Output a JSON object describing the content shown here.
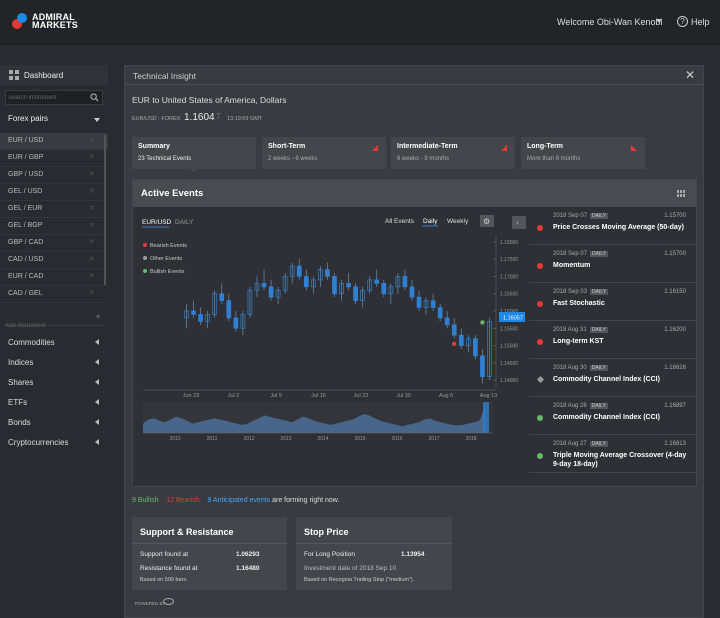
{
  "header": {
    "brand_line1": "ADMIRAL",
    "brand_line2": "MARKETS",
    "welcome": "Welcome Obi-Wan Kenobi",
    "help": "Help"
  },
  "sidebar": {
    "dashboard": "Dashboard",
    "search_placeholder": "Search instrument",
    "forex_label": "Forex pairs",
    "pairs": [
      "EUR / USD",
      "EUR / GBP",
      "GBP / USD",
      "GEL / USD",
      "GEL / EUR",
      "GEL / BGP",
      "GBP / CAD",
      "CAD / USD",
      "EUR / CAD",
      "CAD / GEL"
    ],
    "add_placeholder": "Add instrument",
    "categories": [
      "Commodities",
      "Indices",
      "Shares",
      "ETFs",
      "Bonds",
      "Cryptocurrencies"
    ]
  },
  "panel": {
    "title": "Technical Insight",
    "instrument": "EUR to United States of America, Dollars",
    "symbol_line": "EUR/USD : FOREX",
    "price": "1.1604",
    "price_change": "7",
    "time": "13:19:59 GMT"
  },
  "tabs": [
    {
      "title": "Summary",
      "sub": "23 Technical Events"
    },
    {
      "title": "Short-Term",
      "sub": "2 weeks - 6 weeks"
    },
    {
      "title": "Intermediate-Term",
      "sub": "6 weeks - 9 months"
    },
    {
      "title": "Long-Term",
      "sub": "More than 9 months"
    }
  ],
  "active_events": {
    "title": "Active Events",
    "symbol": "EUR/USD",
    "interval": "DAILY",
    "period_buttons": [
      "All Events",
      "Daily",
      "Weekly"
    ],
    "legend": [
      "Bearish Events",
      "Other Events",
      "Bullish Events"
    ],
    "current_price_label": "1.16057",
    "colors": {
      "bearish": "#e53935",
      "other": "#9e9e9e",
      "bullish": "#66bb6a",
      "candle": "#2f80d0"
    }
  },
  "chart_data": {
    "type": "candlestick",
    "title": "",
    "y_ticks": [
      "1.18000",
      "1.17500",
      "1.17000",
      "1.16500",
      "1.16000",
      "1.15500",
      "1.15000",
      "1.14500",
      "1.14000"
    ],
    "x_ticks": [
      "Jun 23",
      "Jul 2",
      "Jul 9",
      "Jul 16",
      "Jul 23",
      "Jul 30",
      "Aug 6",
      "Aug 13"
    ],
    "overview_x_ticks": [
      "2010",
      "2011",
      "2012",
      "2013",
      "2014",
      "2015",
      "2016",
      "2017",
      "2018"
    ],
    "ylim": [
      1.138,
      1.182
    ],
    "candles": [
      [
        1.158,
        1.162,
        1.155,
        1.16
      ],
      [
        1.16,
        1.163,
        1.158,
        1.159
      ],
      [
        1.159,
        1.161,
        1.156,
        1.157
      ],
      [
        1.157,
        1.16,
        1.155,
        1.159
      ],
      [
        1.159,
        1.166,
        1.158,
        1.165
      ],
      [
        1.165,
        1.168,
        1.162,
        1.163
      ],
      [
        1.163,
        1.165,
        1.157,
        1.158
      ],
      [
        1.158,
        1.16,
        1.154,
        1.155
      ],
      [
        1.155,
        1.16,
        1.153,
        1.159
      ],
      [
        1.159,
        1.167,
        1.158,
        1.166
      ],
      [
        1.166,
        1.17,
        1.164,
        1.168
      ],
      [
        1.168,
        1.172,
        1.166,
        1.167
      ],
      [
        1.167,
        1.169,
        1.163,
        1.164
      ],
      [
        1.164,
        1.167,
        1.162,
        1.166
      ],
      [
        1.166,
        1.171,
        1.165,
        1.17
      ],
      [
        1.17,
        1.174,
        1.168,
        1.173
      ],
      [
        1.173,
        1.175,
        1.169,
        1.17
      ],
      [
        1.17,
        1.172,
        1.166,
        1.167
      ],
      [
        1.167,
        1.17,
        1.165,
        1.169
      ],
      [
        1.169,
        1.173,
        1.167,
        1.172
      ],
      [
        1.172,
        1.174,
        1.169,
        1.17
      ],
      [
        1.17,
        1.171,
        1.164,
        1.165
      ],
      [
        1.165,
        1.169,
        1.163,
        1.168
      ],
      [
        1.168,
        1.171,
        1.166,
        1.167
      ],
      [
        1.167,
        1.168,
        1.162,
        1.163
      ],
      [
        1.163,
        1.167,
        1.161,
        1.166
      ],
      [
        1.166,
        1.17,
        1.165,
        1.169
      ],
      [
        1.169,
        1.172,
        1.167,
        1.168
      ],
      [
        1.168,
        1.169,
        1.164,
        1.165
      ],
      [
        1.165,
        1.168,
        1.162,
        1.167
      ],
      [
        1.167,
        1.171,
        1.165,
        1.17
      ],
      [
        1.17,
        1.172,
        1.166,
        1.167
      ],
      [
        1.167,
        1.169,
        1.163,
        1.164
      ],
      [
        1.164,
        1.166,
        1.16,
        1.161
      ],
      [
        1.161,
        1.164,
        1.159,
        1.163
      ],
      [
        1.163,
        1.165,
        1.16,
        1.161
      ],
      [
        1.161,
        1.162,
        1.157,
        1.158
      ],
      [
        1.158,
        1.16,
        1.155,
        1.156
      ],
      [
        1.156,
        1.158,
        1.152,
        1.153
      ],
      [
        1.153,
        1.155,
        1.149,
        1.15
      ],
      [
        1.15,
        1.153,
        1.148,
        1.152
      ],
      [
        1.152,
        1.153,
        1.146,
        1.147
      ],
      [
        1.147,
        1.149,
        1.139,
        1.141
      ],
      [
        1.141,
        1.158,
        1.14,
        1.157
      ]
    ],
    "events": [
      {
        "index": 42,
        "price": 1.1567,
        "kind": "bullish"
      },
      {
        "index": 38,
        "price": 1.1505,
        "kind": "bearish"
      }
    ],
    "overview_volume": [
      0.35,
      0.5,
      0.55,
      0.45,
      0.4,
      0.5,
      0.6,
      0.55,
      0.45,
      0.35,
      0.4,
      0.45,
      0.5,
      0.55,
      0.5,
      0.45,
      0.4,
      0.35,
      0.3,
      0.35,
      0.45,
      0.55,
      0.65,
      0.6,
      0.55,
      0.5,
      0.45,
      0.4,
      0.5,
      0.6,
      0.55,
      0.45,
      0.4,
      0.35,
      0.3,
      0.35,
      0.4,
      0.45,
      0.5,
      0.6,
      0.7,
      0.65,
      0.55,
      0.45,
      0.4,
      0.35,
      0.3,
      0.25,
      0.3,
      0.35,
      0.4,
      0.5,
      0.55,
      0.45,
      0.4,
      0.35,
      0.3,
      0.28,
      0.3,
      0.35,
      0.4,
      0.45,
      1.0
    ]
  },
  "events": [
    {
      "date": "2018 Sep 07",
      "price": "1.15700",
      "name": "Price Crosses Moving Average (50-day)",
      "kind": "bearish"
    },
    {
      "date": "2018 Sep 07",
      "price": "1.15700",
      "name": "Momentum",
      "kind": "bearish"
    },
    {
      "date": "2018 Sep 03",
      "price": "1.16150",
      "name": "Fast Stochastic",
      "kind": "bearish"
    },
    {
      "date": "2018 Aug 31",
      "price": "1.16200",
      "name": "Long-term KST",
      "kind": "bearish"
    },
    {
      "date": "2018 Aug 30",
      "price": "1.16626",
      "name": "Commodity Channel Index (CCI)",
      "kind": "other"
    },
    {
      "date": "2018 Aug 28",
      "price": "1.16897",
      "name": "Commodity Channel Index (CCI)",
      "kind": "bullish"
    },
    {
      "date": "2018 Aug 27",
      "price": "1.16813",
      "name": "Triple Moving Average Crossover (4-day 9-day 18-day)",
      "kind": "bullish"
    }
  ],
  "event_badge": "DAILY",
  "summary": {
    "bullish": "9 Bullish",
    "bearish": "12 Bearish",
    "anticipated": "9 Anticipated events",
    "tail": "are forming right now."
  },
  "support": {
    "title": "Support & Resistance",
    "support_label": "Support found at",
    "support_value": "1.06293",
    "resistance_label": "Resistance found at",
    "resistance_value": "1.16480",
    "note": "Based on 500 bars."
  },
  "stop": {
    "title": "Stop Price",
    "label": "For Long Position",
    "value": "1.13954",
    "investment": "Investment date of 2018 Sep 10",
    "note": "Based on Recognia Trailing Stop (\"medium\")."
  },
  "powered_by": "POWERED BY"
}
